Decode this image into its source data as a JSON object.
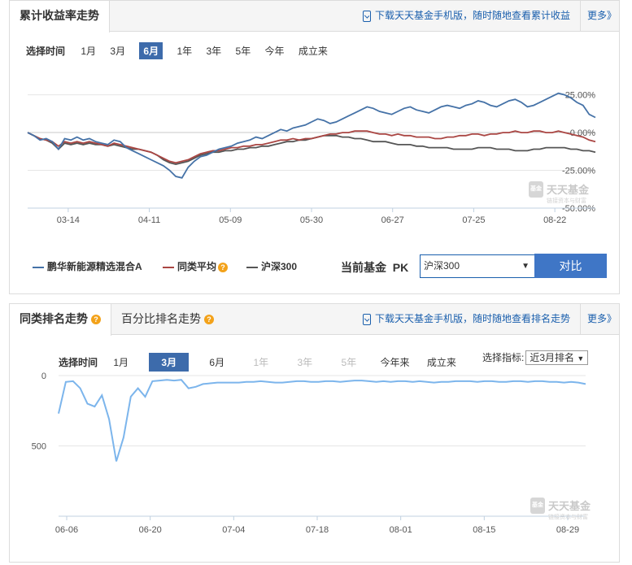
{
  "panel1": {
    "tab_title": "累计收益率走势",
    "download_text": "下载天天基金手机版，随时随地查看累计收益",
    "more_label": "更多》",
    "time_label": "选择时间",
    "time_options": [
      "1月",
      "3月",
      "6月",
      "1年",
      "3年",
      "5年",
      "今年",
      "成立来"
    ],
    "selected_time": "6月",
    "legend": [
      {
        "name": "鹏华新能源精选混合A",
        "color": "#4572a7"
      },
      {
        "name": "同类平均",
        "color": "#aa4643"
      },
      {
        "name": "沪深300",
        "color": "#555555"
      }
    ],
    "pk_label_1": "当前基金",
    "pk_label_2": "PK",
    "pk_select_value": "沪深300",
    "compare_button": "对比",
    "watermark_main": "天天基金",
    "watermark_sub": "链接资本与财富",
    "watermark_badge": "基金"
  },
  "panel2": {
    "tab_active": "同类排名走势",
    "tab_other": "百分比排名走势",
    "download_text": "下载天天基金手机版，随时随地查看排名走势",
    "more_label": "更多》",
    "time_label": "选择时间",
    "time_options": [
      "1月",
      "3月",
      "6月",
      "1年",
      "3年",
      "5年",
      "今年来",
      "成立来"
    ],
    "disabled_options": [
      "1年",
      "3年",
      "5年"
    ],
    "selected_time": "3月",
    "indicator_label": "选择指标:",
    "indicator_value": "近3月排名",
    "watermark_main": "天天基金",
    "watermark_sub": "链接资本与财富",
    "watermark_badge": "基金"
  },
  "chart_data": [
    {
      "type": "line",
      "x_tick_labels": [
        "03-14",
        "04-11",
        "05-09",
        "05-30",
        "06-27",
        "07-25",
        "08-22"
      ],
      "y_tick_labels": [
        "25.00%",
        "0.00%",
        "-25.00%",
        "-50.00%"
      ],
      "y_ticks": [
        25,
        0,
        -25,
        -50
      ],
      "ylim": [
        -50,
        28
      ],
      "grid": true,
      "legend_position": "bottom",
      "series": [
        {
          "name": "鹏华新能源精选混合A",
          "color": "#4572a7",
          "values": [
            0,
            -2,
            -5,
            -4,
            -6,
            -11,
            -4,
            -5,
            -3,
            -5,
            -4,
            -6,
            -7,
            -8,
            -5,
            -6,
            -10,
            -12,
            -14,
            -16,
            -18,
            -20,
            -22,
            -25,
            -29,
            -30,
            -23,
            -19,
            -16,
            -15,
            -13,
            -11,
            -10,
            -9,
            -7,
            -6,
            -5,
            -3,
            -4,
            -2,
            0,
            2,
            1,
            3,
            4,
            5,
            7,
            9,
            8,
            6,
            7,
            9,
            11,
            13,
            15,
            17,
            16,
            14,
            13,
            12,
            14,
            16,
            17,
            15,
            14,
            13,
            15,
            17,
            18,
            17,
            16,
            18,
            19,
            21,
            20,
            18,
            17,
            19,
            21,
            22,
            20,
            17,
            18,
            20,
            22,
            24,
            26,
            25,
            23,
            20,
            18,
            12,
            10
          ]
        },
        {
          "name": "同类平均",
          "color": "#aa4643",
          "values": [
            0,
            -2,
            -4,
            -5,
            -6,
            -9,
            -6,
            -7,
            -6,
            -7,
            -6,
            -7,
            -8,
            -9,
            -7,
            -8,
            -9,
            -10,
            -11,
            -12,
            -13,
            -15,
            -17,
            -19,
            -20,
            -19,
            -18,
            -16,
            -14,
            -13,
            -12,
            -12,
            -11,
            -10,
            -10,
            -9,
            -9,
            -8,
            -8,
            -7,
            -6,
            -5,
            -5,
            -4,
            -5,
            -4,
            -4,
            -3,
            -2,
            -1,
            -1,
            0,
            0,
            1,
            1,
            1,
            0,
            -1,
            -1,
            -2,
            -1,
            -2,
            -2,
            -3,
            -3,
            -3,
            -4,
            -4,
            -3,
            -3,
            -2,
            -2,
            -1,
            -1,
            -2,
            -1,
            -1,
            0,
            0,
            1,
            0,
            0,
            1,
            1,
            0,
            0,
            1,
            0,
            -1,
            -2,
            -3,
            -5,
            -6
          ]
        },
        {
          "name": "沪深300",
          "color": "#555555",
          "values": [
            0,
            -2,
            -4,
            -5,
            -7,
            -11,
            -7,
            -8,
            -7,
            -8,
            -7,
            -8,
            -8,
            -9,
            -8,
            -9,
            -10,
            -11,
            -11,
            -12,
            -13,
            -15,
            -18,
            -20,
            -21,
            -20,
            -19,
            -17,
            -15,
            -14,
            -13,
            -13,
            -12,
            -12,
            -11,
            -11,
            -10,
            -10,
            -9,
            -9,
            -8,
            -7,
            -6,
            -6,
            -5,
            -5,
            -4,
            -3,
            -2,
            -2,
            -2,
            -3,
            -3,
            -4,
            -4,
            -5,
            -6,
            -6,
            -6,
            -7,
            -8,
            -8,
            -8,
            -9,
            -9,
            -10,
            -10,
            -10,
            -10,
            -11,
            -11,
            -11,
            -11,
            -10,
            -10,
            -10,
            -11,
            -11,
            -11,
            -12,
            -12,
            -12,
            -11,
            -11,
            -10,
            -10,
            -10,
            -10,
            -11,
            -11,
            -12,
            -12,
            -13
          ]
        }
      ]
    },
    {
      "type": "line",
      "x_tick_labels": [
        "06-06",
        "06-20",
        "07-04",
        "07-18",
        "08-01",
        "08-15",
        "08-29"
      ],
      "y_tick_labels": [
        "0",
        "500"
      ],
      "y_ticks": [
        0,
        500
      ],
      "ylim": [
        0,
        1000
      ],
      "y_inverted": true,
      "grid": true,
      "series": [
        {
          "name": "",
          "color": "#7cb5ec",
          "values": [
            270,
            45,
            40,
            90,
            200,
            220,
            140,
            310,
            610,
            440,
            150,
            90,
            150,
            40,
            35,
            30,
            35,
            30,
            90,
            80,
            60,
            55,
            50,
            50,
            50,
            50,
            45,
            45,
            40,
            45,
            50,
            50,
            45,
            40,
            40,
            45,
            45,
            40,
            40,
            45,
            40,
            35,
            35,
            40,
            45,
            40,
            45,
            40,
            40,
            45,
            40,
            45,
            50,
            45,
            45,
            40,
            40,
            40,
            45,
            40,
            40,
            45,
            45,
            40,
            40,
            45,
            40,
            40,
            45,
            45,
            50,
            45,
            50,
            60
          ]
        }
      ]
    }
  ]
}
